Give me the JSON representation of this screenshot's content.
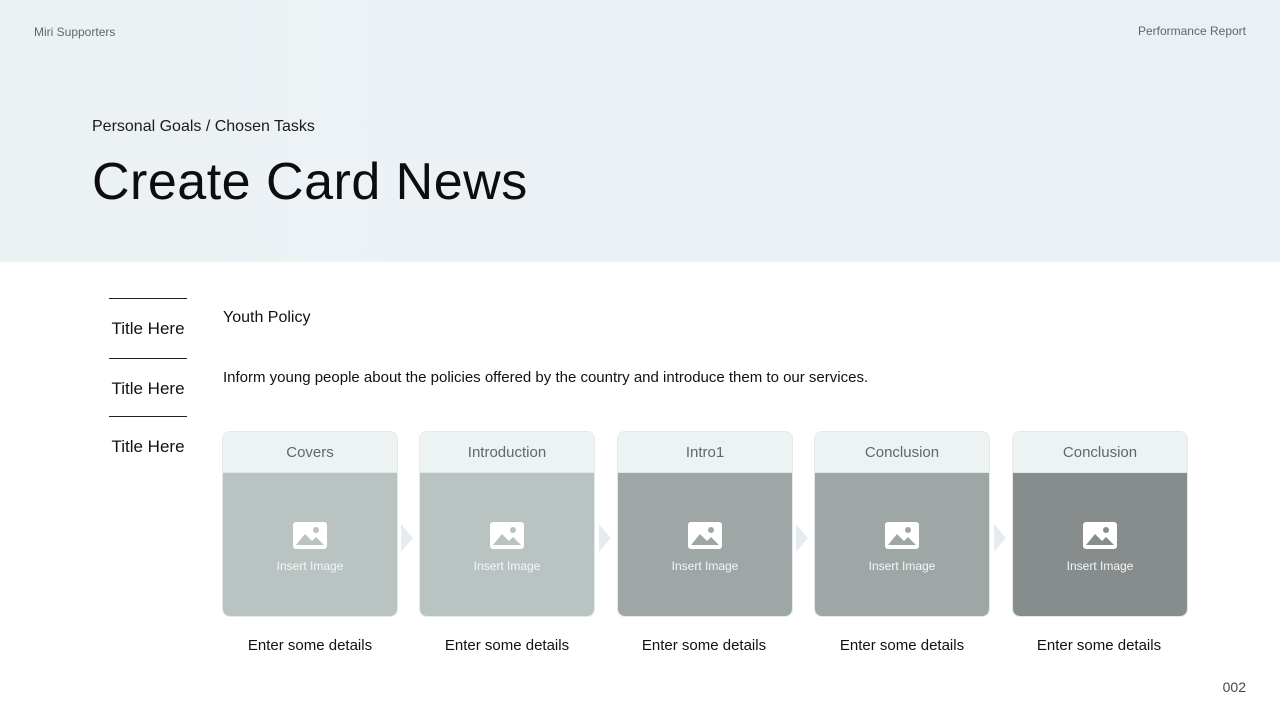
{
  "header": {
    "brand": "Miri Supporters",
    "report_label": "Performance Report",
    "subtitle": "Personal Goals / Chosen Tasks",
    "title": "Create Card News"
  },
  "sidebar": {
    "items": [
      {
        "label": "Title Here"
      },
      {
        "label": "Title Here"
      },
      {
        "label": "Title Here"
      }
    ]
  },
  "content": {
    "topic": "Youth Policy",
    "description": "Inform young people about the policies offered by the country and introduce them to our services."
  },
  "cards": [
    {
      "header": "Covers",
      "placeholder": "Insert Image",
      "caption": "Enter some details",
      "body_color": "#b9c3c2"
    },
    {
      "header": "Introduction",
      "placeholder": "Insert Image",
      "caption": "Enter some details",
      "body_color": "#b9c3c2"
    },
    {
      "header": "Intro1",
      "placeholder": "Insert Image",
      "caption": "Enter some details",
      "body_color": "#9fa7a6"
    },
    {
      "header": "Conclusion",
      "placeholder": "Insert Image",
      "caption": "Enter some details",
      "body_color": "#9fa7a6"
    },
    {
      "header": "Conclusion",
      "placeholder": "Insert Image",
      "caption": "Enter some details",
      "body_color": "#878d8c"
    }
  ],
  "icons": {
    "card_image": "image-icon",
    "step_arrow": "chevron-right-icon"
  },
  "colors": {
    "hero_background": "#ecf2f4",
    "card_header": "#edf3f3",
    "arrow": "#e5ecef"
  },
  "footer": {
    "page_number": "002"
  }
}
